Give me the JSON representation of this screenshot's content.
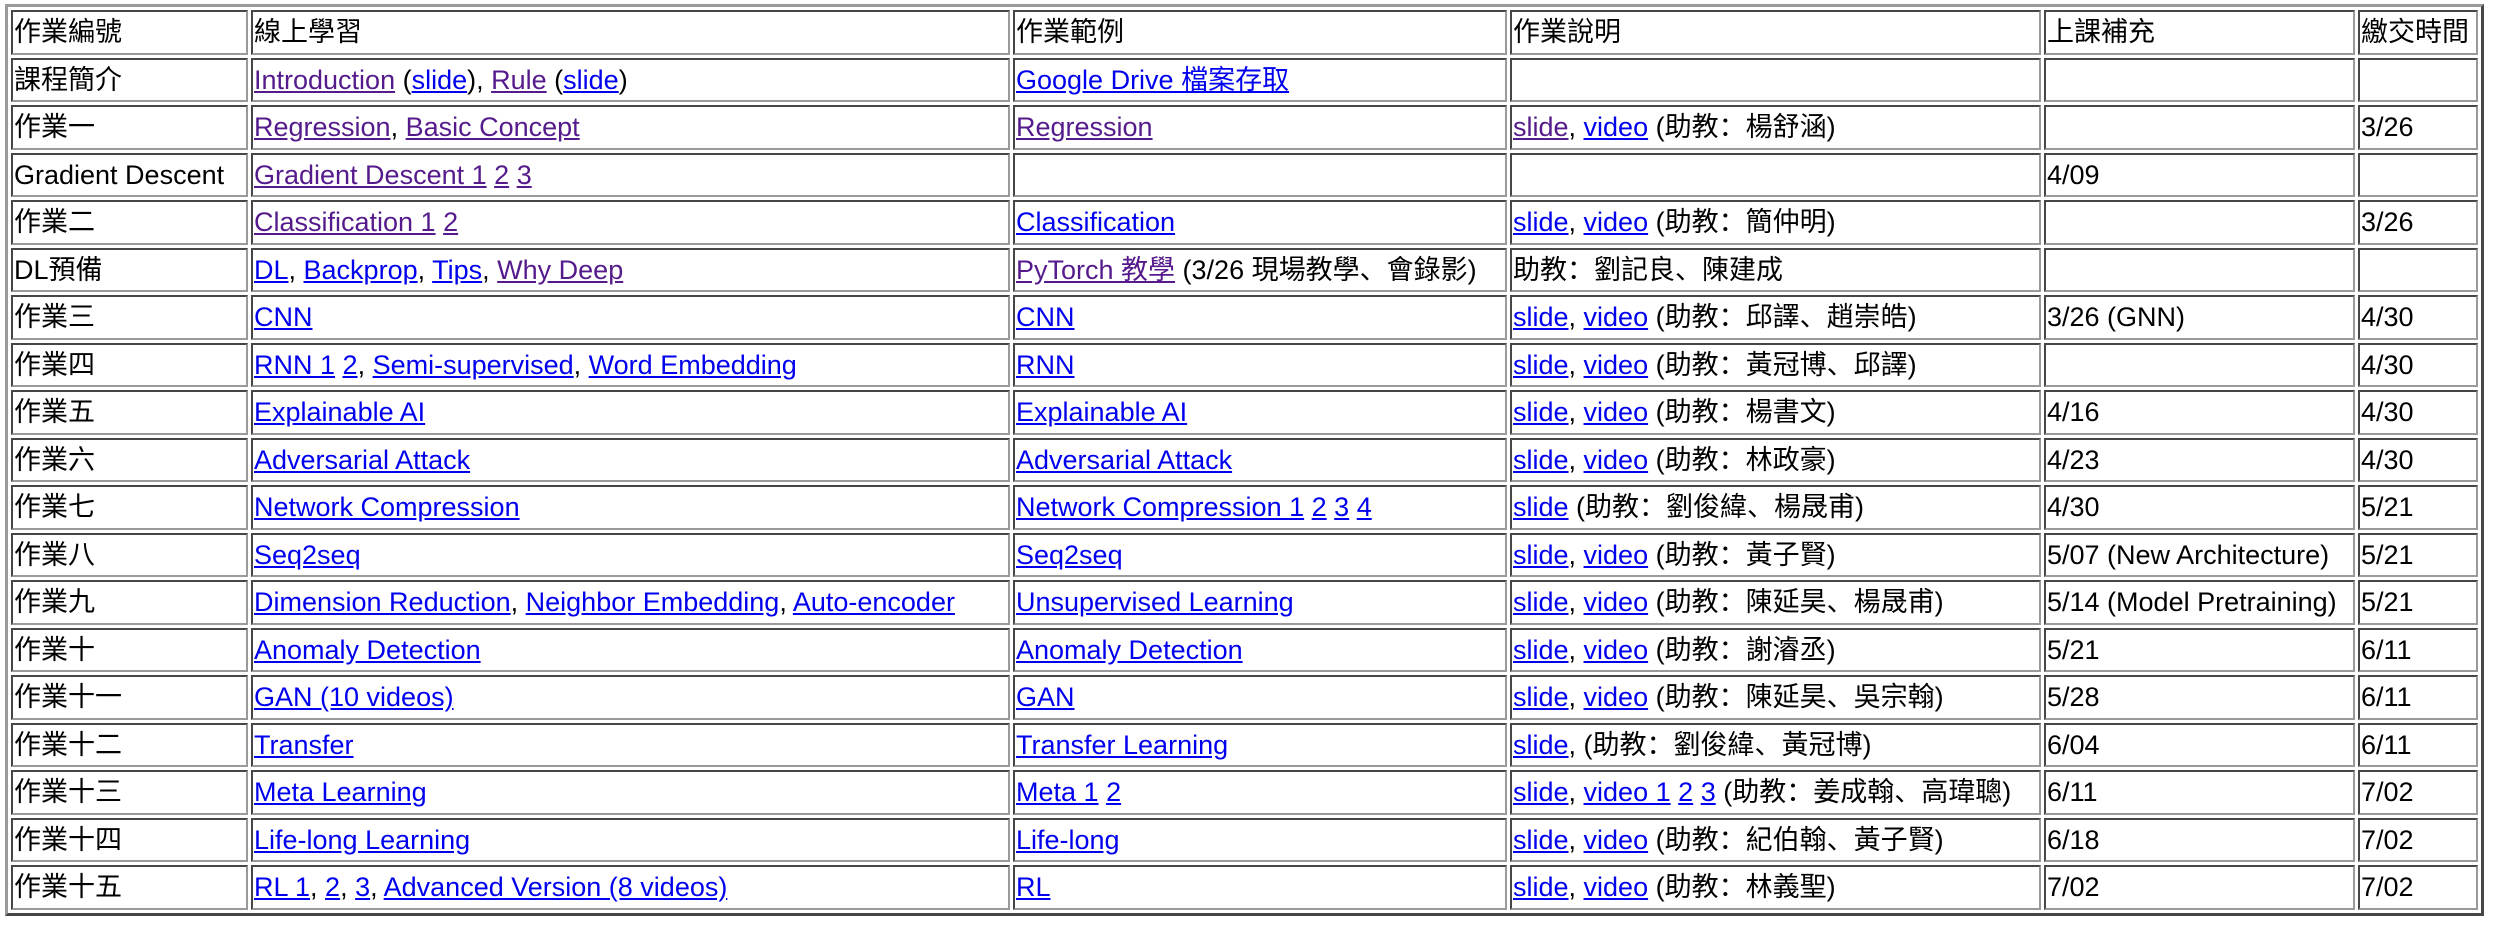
{
  "header": [
    "作業編號",
    "線上學習",
    "作業範例",
    "作業說明",
    "上課補充",
    "繳交時間"
  ],
  "rows": [
    {
      "num": "課程簡介",
      "online": [
        {
          "t": "Introduction",
          "l": 1,
          "v": 1
        },
        {
          "t": " ("
        },
        {
          "t": "slide",
          "l": 1
        },
        {
          "t": "), "
        },
        {
          "t": "Rule",
          "l": 1,
          "v": 1
        },
        {
          "t": " ("
        },
        {
          "t": "slide",
          "l": 1
        },
        {
          "t": ")"
        }
      ],
      "example": [
        {
          "t": "Google Drive 檔案存取",
          "l": 1
        }
      ],
      "desc": [],
      "supp": "",
      "due": ""
    },
    {
      "num": "作業一",
      "online": [
        {
          "t": "Regression",
          "l": 1,
          "v": 1
        },
        {
          "t": ", "
        },
        {
          "t": "Basic Concept",
          "l": 1,
          "v": 1
        }
      ],
      "example": [
        {
          "t": "Regression",
          "l": 1,
          "v": 1
        }
      ],
      "desc": [
        {
          "t": "slide",
          "l": 1,
          "v": 1
        },
        {
          "t": ", "
        },
        {
          "t": "video",
          "l": 1
        },
        {
          "t": " (助教：楊舒涵)"
        }
      ],
      "supp": "",
      "due": "3/26"
    },
    {
      "num": "Gradient Descent",
      "online": [
        {
          "t": "Gradient Descent 1",
          "l": 1,
          "v": 1
        },
        {
          "t": " "
        },
        {
          "t": "2",
          "l": 1,
          "v": 1
        },
        {
          "t": " "
        },
        {
          "t": "3",
          "l": 1,
          "v": 1
        }
      ],
      "example": [],
      "desc": [],
      "supp": "4/09",
      "due": ""
    },
    {
      "num": "作業二",
      "online": [
        {
          "t": "Classification 1",
          "l": 1,
          "v": 1
        },
        {
          "t": " "
        },
        {
          "t": "2",
          "l": 1,
          "v": 1
        }
      ],
      "example": [
        {
          "t": "Classification",
          "l": 1
        }
      ],
      "desc": [
        {
          "t": "slide",
          "l": 1
        },
        {
          "t": ", "
        },
        {
          "t": "video",
          "l": 1
        },
        {
          "t": " (助教：簡仲明)"
        }
      ],
      "supp": "",
      "due": "3/26"
    },
    {
      "num": "DL預備",
      "online": [
        {
          "t": "DL",
          "l": 1
        },
        {
          "t": ", "
        },
        {
          "t": "Backprop",
          "l": 1
        },
        {
          "t": ", "
        },
        {
          "t": "Tips",
          "l": 1
        },
        {
          "t": ", "
        },
        {
          "t": "Why Deep",
          "l": 1,
          "v": 1
        }
      ],
      "example": [
        {
          "t": "PyTorch 教學",
          "l": 1,
          "v": 1
        },
        {
          "t": " (3/26 現場教學、會錄影)"
        }
      ],
      "desc": [
        {
          "t": "助教：劉記良、陳建成"
        }
      ],
      "supp": "",
      "due": ""
    },
    {
      "num": "作業三",
      "online": [
        {
          "t": "CNN",
          "l": 1
        }
      ],
      "example": [
        {
          "t": "CNN",
          "l": 1
        }
      ],
      "desc": [
        {
          "t": "slide",
          "l": 1
        },
        {
          "t": ", "
        },
        {
          "t": "video",
          "l": 1
        },
        {
          "t": " (助教：邱譯、趙崇皓)"
        }
      ],
      "supp": "3/26 (GNN)",
      "due": "4/30"
    },
    {
      "num": "作業四",
      "online": [
        {
          "t": "RNN 1",
          "l": 1
        },
        {
          "t": " "
        },
        {
          "t": "2",
          "l": 1
        },
        {
          "t": ", "
        },
        {
          "t": "Semi-supervised",
          "l": 1
        },
        {
          "t": ", "
        },
        {
          "t": "Word Embedding",
          "l": 1
        }
      ],
      "example": [
        {
          "t": "RNN",
          "l": 1
        }
      ],
      "desc": [
        {
          "t": "slide",
          "l": 1
        },
        {
          "t": ", "
        },
        {
          "t": "video",
          "l": 1
        },
        {
          "t": " (助教：黃冠博、邱譯)"
        }
      ],
      "supp": "",
      "due": "4/30"
    },
    {
      "num": "作業五",
      "online": [
        {
          "t": "Explainable AI",
          "l": 1
        }
      ],
      "example": [
        {
          "t": "Explainable AI",
          "l": 1
        }
      ],
      "desc": [
        {
          "t": "slide",
          "l": 1
        },
        {
          "t": ", "
        },
        {
          "t": "video",
          "l": 1
        },
        {
          "t": " (助教：楊書文)"
        }
      ],
      "supp": "4/16",
      "due": "4/30"
    },
    {
      "num": "作業六",
      "online": [
        {
          "t": "Adversarial Attack",
          "l": 1
        }
      ],
      "example": [
        {
          "t": "Adversarial Attack",
          "l": 1
        }
      ],
      "desc": [
        {
          "t": "slide",
          "l": 1
        },
        {
          "t": ", "
        },
        {
          "t": "video",
          "l": 1
        },
        {
          "t": " (助教：林政豪)"
        }
      ],
      "supp": "4/23",
      "due": "4/30"
    },
    {
      "num": "作業七",
      "online": [
        {
          "t": "Network Compression",
          "l": 1
        }
      ],
      "example": [
        {
          "t": "Network Compression 1",
          "l": 1
        },
        {
          "t": " "
        },
        {
          "t": "2",
          "l": 1
        },
        {
          "t": " "
        },
        {
          "t": "3",
          "l": 1
        },
        {
          "t": " "
        },
        {
          "t": "4",
          "l": 1
        }
      ],
      "desc": [
        {
          "t": "slide",
          "l": 1
        },
        {
          "t": " (助教：劉俊緯、楊晟甫)"
        }
      ],
      "supp": "4/30",
      "due": "5/21"
    },
    {
      "num": "作業八",
      "online": [
        {
          "t": "Seq2seq",
          "l": 1
        }
      ],
      "example": [
        {
          "t": "Seq2seq",
          "l": 1
        }
      ],
      "desc": [
        {
          "t": "slide",
          "l": 1
        },
        {
          "t": ", "
        },
        {
          "t": "video",
          "l": 1
        },
        {
          "t": " (助教：黃子賢)"
        }
      ],
      "supp": "5/07 (New Architecture)",
      "due": "5/21"
    },
    {
      "num": "作業九",
      "online": [
        {
          "t": "Dimension Reduction",
          "l": 1
        },
        {
          "t": ", "
        },
        {
          "t": "Neighbor Embedding",
          "l": 1
        },
        {
          "t": ", "
        },
        {
          "t": "Auto-encoder",
          "l": 1
        }
      ],
      "example": [
        {
          "t": "Unsupervised Learning",
          "l": 1
        }
      ],
      "desc": [
        {
          "t": "slide",
          "l": 1
        },
        {
          "t": ", "
        },
        {
          "t": "video",
          "l": 1
        },
        {
          "t": " (助教：陳延昊、楊晟甫)"
        }
      ],
      "supp": "5/14 (Model Pretraining)",
      "due": "5/21"
    },
    {
      "num": "作業十",
      "online": [
        {
          "t": "Anomaly Detection",
          "l": 1
        }
      ],
      "example": [
        {
          "t": "Anomaly Detection",
          "l": 1
        }
      ],
      "desc": [
        {
          "t": "slide",
          "l": 1
        },
        {
          "t": ", "
        },
        {
          "t": "video",
          "l": 1
        },
        {
          "t": " (助教：謝濬丞)"
        }
      ],
      "supp": "5/21",
      "due": "6/11"
    },
    {
      "num": "作業十一",
      "online": [
        {
          "t": "GAN (10 videos)",
          "l": 1
        }
      ],
      "example": [
        {
          "t": "GAN",
          "l": 1
        }
      ],
      "desc": [
        {
          "t": "slide",
          "l": 1
        },
        {
          "t": ", "
        },
        {
          "t": "video",
          "l": 1
        },
        {
          "t": " (助教：陳延昊、吳宗翰)"
        }
      ],
      "supp": "5/28",
      "due": "6/11"
    },
    {
      "num": "作業十二",
      "online": [
        {
          "t": "Transfer",
          "l": 1
        }
      ],
      "example": [
        {
          "t": "Transfer Learning",
          "l": 1
        }
      ],
      "desc": [
        {
          "t": "slide",
          "l": 1
        },
        {
          "t": ", (助教：劉俊緯、黃冠博)"
        }
      ],
      "supp": "6/04",
      "due": "6/11"
    },
    {
      "num": "作業十三",
      "online": [
        {
          "t": "Meta Learning",
          "l": 1
        }
      ],
      "example": [
        {
          "t": "Meta 1",
          "l": 1
        },
        {
          "t": " "
        },
        {
          "t": "2",
          "l": 1
        }
      ],
      "desc": [
        {
          "t": "slide",
          "l": 1
        },
        {
          "t": ", "
        },
        {
          "t": "video 1",
          "l": 1
        },
        {
          "t": " "
        },
        {
          "t": "2",
          "l": 1
        },
        {
          "t": " "
        },
        {
          "t": "3",
          "l": 1
        },
        {
          "t": " (助教：姜成翰、高瑋聰)"
        }
      ],
      "supp": "6/11",
      "due": "7/02"
    },
    {
      "num": "作業十四",
      "online": [
        {
          "t": "Life-long Learning",
          "l": 1
        }
      ],
      "example": [
        {
          "t": "Life-long",
          "l": 1
        }
      ],
      "desc": [
        {
          "t": "slide",
          "l": 1
        },
        {
          "t": ", "
        },
        {
          "t": "video",
          "l": 1
        },
        {
          "t": " (助教：紀伯翰、黃子賢)"
        }
      ],
      "supp": "6/18",
      "due": "7/02"
    },
    {
      "num": "作業十五",
      "online": [
        {
          "t": "RL 1",
          "l": 1
        },
        {
          "t": ", "
        },
        {
          "t": "2",
          "l": 1
        },
        {
          "t": ", "
        },
        {
          "t": "3",
          "l": 1
        },
        {
          "t": ", "
        },
        {
          "t": "Advanced Version (8 videos)",
          "l": 1
        }
      ],
      "example": [
        {
          "t": "RL",
          "l": 1
        }
      ],
      "desc": [
        {
          "t": "slide",
          "l": 1
        },
        {
          "t": ", "
        },
        {
          "t": "video",
          "l": 1
        },
        {
          "t": " (助教：林義聖)"
        }
      ],
      "supp": "7/02",
      "due": "7/02"
    }
  ]
}
